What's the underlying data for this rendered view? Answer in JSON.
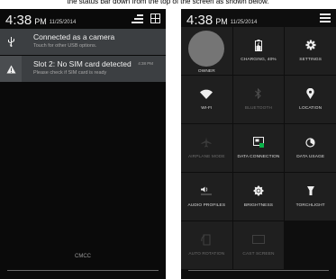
{
  "caption": "the status bar down from the top of the screen as shown below.",
  "left_phone": {
    "time": "4:38",
    "ampm": "PM",
    "date": "11/25/2014",
    "notifications": [
      {
        "title": "Connected as a camera",
        "subtitle": "Touch for other USB options.",
        "time": "",
        "icon": "usb-icon"
      },
      {
        "title": "Slot 2: No SIM card detected",
        "subtitle": "Please check if SIM card is ready",
        "time": "4:38 PM",
        "icon": "warning-icon"
      }
    ],
    "carrier": "CMCC"
  },
  "right_phone": {
    "time": "4:38",
    "ampm": "PM",
    "date": "11/25/2014",
    "tiles": [
      {
        "label": "OWNER",
        "icon": "avatar",
        "on": true
      },
      {
        "label": "CHARGING, 40%",
        "icon": "battery-icon",
        "on": true
      },
      {
        "label": "SETTINGS",
        "icon": "gear-icon",
        "on": true
      },
      {
        "label": "WI-FI",
        "icon": "wifi-icon",
        "on": true
      },
      {
        "label": "BLUETOOTH",
        "icon": "bluetooth-icon",
        "on": false
      },
      {
        "label": "LOCATION",
        "icon": "location-pin-icon",
        "on": true
      },
      {
        "label": "AIRPLANE MODE",
        "icon": "airplane-icon",
        "on": false
      },
      {
        "label": "DATA CONNECTION",
        "icon": "data-connection-icon",
        "on": true
      },
      {
        "label": "DATA USAGE",
        "icon": "data-usage-icon",
        "on": true
      },
      {
        "label": "AUDIO PROFILES",
        "icon": "speaker-icon",
        "on": true
      },
      {
        "label": "BRIGHTNESS",
        "icon": "brightness-icon",
        "on": true
      },
      {
        "label": "TORCHLIGHT",
        "icon": "torch-icon",
        "on": true
      },
      {
        "label": "AUTO ROTATION",
        "icon": "rotation-icon",
        "on": false
      },
      {
        "label": "CAST SCREEN",
        "icon": "cast-icon",
        "on": false
      }
    ]
  }
}
